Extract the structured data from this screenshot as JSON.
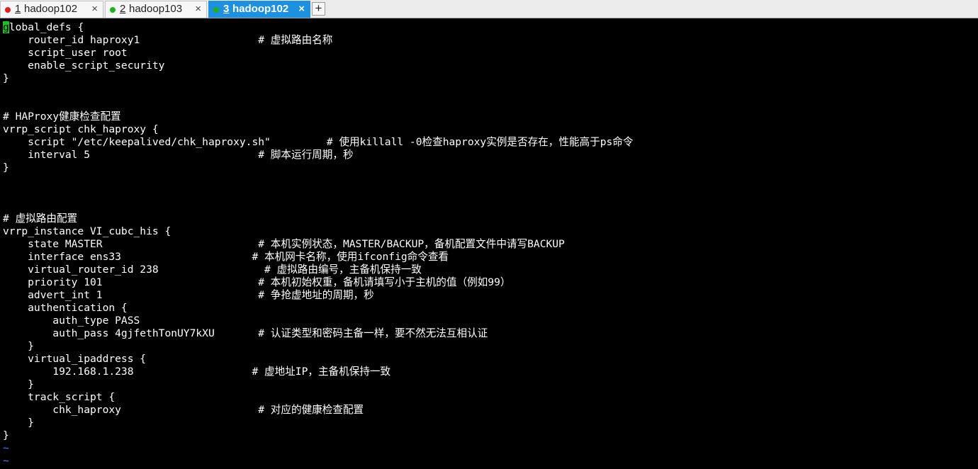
{
  "tabs": [
    {
      "number": "1",
      "label": " hadoop102",
      "dot_color": "#e02020",
      "active": false
    },
    {
      "number": "2",
      "label": " hadoop103",
      "dot_color": "#20b020",
      "active": false
    },
    {
      "number": "3",
      "label": " hadoop102",
      "dot_color": "#20b020",
      "active": true
    }
  ],
  "tab_close_glyph": "×",
  "add_tab_glyph": "+",
  "terminal": {
    "cursor_char": "g",
    "first_line_rest": "lobal_defs {",
    "lines": [
      "    router_id haproxy1                   # 虚拟路由名称",
      "    script_user root",
      "    enable_script_security",
      "}",
      "",
      "",
      "# HAProxy健康检查配置",
      "vrrp_script chk_haproxy {",
      "    script \"/etc/keepalived/chk_haproxy.sh\"         # 使用killall -0检查haproxy实例是否存在，性能高于ps命令",
      "    interval 5                           # 脚本运行周期，秒",
      "}",
      "",
      "",
      "",
      "# 虚拟路由配置",
      "vrrp_instance VI_cubc_his {",
      "    state MASTER                         # 本机实例状态，MASTER/BACKUP，备机配置文件中请写BACKUP",
      "    interface ens33                     # 本机网卡名称，使用ifconfig命令查看",
      "    virtual_router_id 238                 # 虚拟路由编号，主备机保持一致",
      "    priority 101                         # 本机初始权重，备机请填写小于主机的值（例如99）",
      "    advert_int 1                         # 争抢虚地址的周期，秒",
      "    authentication {",
      "        auth_type PASS",
      "        auth_pass 4gjfethTonUY7kXU       # 认证类型和密码主备一样，要不然无法互相认证",
      "    }",
      "    virtual_ipaddress {",
      "        192.168.1.238                   # 虚地址IP，主备机保持一致",
      "    }",
      "    track_script {",
      "        chk_haproxy                      # 对应的健康检查配置",
      "    }",
      "}"
    ],
    "tildes": [
      "~",
      "~"
    ]
  },
  "colors": {
    "background": "#000000",
    "text": "#ffffff",
    "cursor": "#1ec01e",
    "tilde": "#5078ff",
    "active_tab": "#1e90e0"
  }
}
